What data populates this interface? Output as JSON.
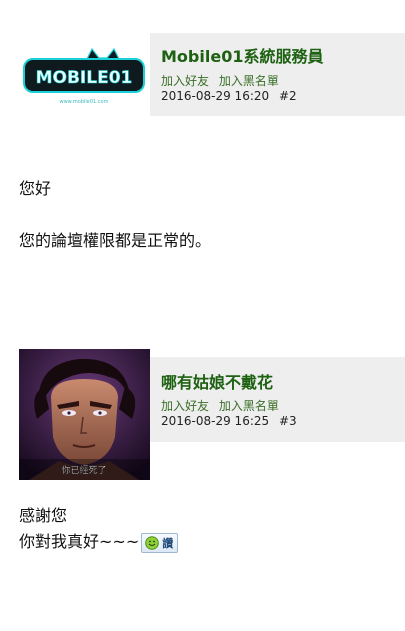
{
  "posts": [
    {
      "username": "Mobile01系統服務員",
      "add_friend": "加入好友",
      "add_blacklist": "加入黑名單",
      "datetime": "2016-08-29 16:20",
      "post_number": "#2",
      "avatar": {
        "logo_text": "MOBILE01",
        "logo_sub": "www.mobile01.com",
        "bg_color": "#0f1a1f",
        "accent_color": "#1ad0d8"
      },
      "body": [
        "您好",
        "您的論壇權限都是正常的。"
      ]
    },
    {
      "username": "哪有姑娘不戴花",
      "add_friend": "加入好友",
      "add_blacklist": "加入黑名單",
      "datetime": "2016-08-29 16:25",
      "post_number": "#3",
      "avatar": {
        "caption": "你已經死了"
      },
      "body": [
        "感謝您",
        "你對我真好~~~"
      ],
      "like_label": "讚"
    }
  ],
  "colors": {
    "username": "#1e6112",
    "action_link": "#3a6f28",
    "info_bg": "#eeeeee"
  }
}
